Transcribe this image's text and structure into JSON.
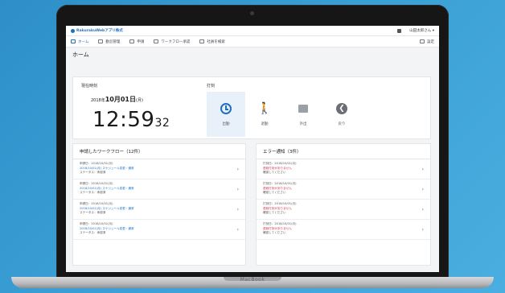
{
  "device": {
    "brand": "MacBook"
  },
  "app": {
    "logo_text": "RakurakuWeb‌アプリ株式",
    "user": "山田太郎さん ▾"
  },
  "nav": {
    "items": [
      {
        "label": "ホーム",
        "icon": "home-icon",
        "active": true
      },
      {
        "label": "勤怠管理",
        "icon": "calendar-icon",
        "active": false
      },
      {
        "label": "申請",
        "icon": "document-icon",
        "active": false
      },
      {
        "label": "ワークフロー承認",
        "icon": "workflow-icon",
        "active": false
      },
      {
        "label": "社員を検索",
        "icon": "people-icon",
        "active": false
      }
    ],
    "right_label": "設定"
  },
  "page": {
    "title": "ホーム"
  },
  "clock": {
    "current_label": "現在時刻",
    "date_prefix": "2018年",
    "date_main": "10月01日",
    "date_suffix": "(月)",
    "time_main": "12:59",
    "time_sec": "32",
    "punch_label": "打刻",
    "buttons": [
      {
        "label": "出勤",
        "icon": "clock-icon"
      },
      {
        "label": "退勤",
        "icon": "walking-icon"
      },
      {
        "label": "外出",
        "icon": "memo-icon"
      },
      {
        "label": "戻り",
        "icon": "return-icon"
      }
    ]
  },
  "workflow": {
    "title": "申請したワークフロー（12件）",
    "rows": [
      {
        "l1": "申請日：2018/10/01(月)",
        "l2": "2018/10/01(月) スケジュール変更・通常",
        "l3": "ステータス：承認済"
      },
      {
        "l1": "申請日：2018/10/01(月)",
        "l2": "2018/10/01(月) スケジュール変更・通常",
        "l3": "ステータス：承認済"
      },
      {
        "l1": "申請日：2018/10/01(月)",
        "l2": "2018/10/01(月) スケジュール変更・通常",
        "l3": "ステータス：承認済"
      },
      {
        "l1": "申請日：2018/10/01(月)",
        "l2": "2018/10/01(月) スケジュール変更・通常",
        "l3": "ステータス：承認済"
      }
    ]
  },
  "errors": {
    "title": "エラー通知（3件）",
    "rows": [
      {
        "l1": "打刻日：2018/10/01(月)",
        "l2": "退勤打刻がありません",
        "l3": "確認してください"
      },
      {
        "l1": "打刻日：2018/10/01(月)",
        "l2": "退勤打刻がありません",
        "l3": "確認してください"
      },
      {
        "l1": "打刻日：2018/10/01(月)",
        "l2": "退勤打刻がありません",
        "l3": "確認してください"
      },
      {
        "l1": "打刻日：2018/10/01(月)",
        "l2": "退勤打刻がありません",
        "l3": "確認してください"
      }
    ]
  },
  "colors": {
    "accent": "#1f6fc0",
    "error": "#d0344b",
    "background": "#3a9fd4"
  }
}
